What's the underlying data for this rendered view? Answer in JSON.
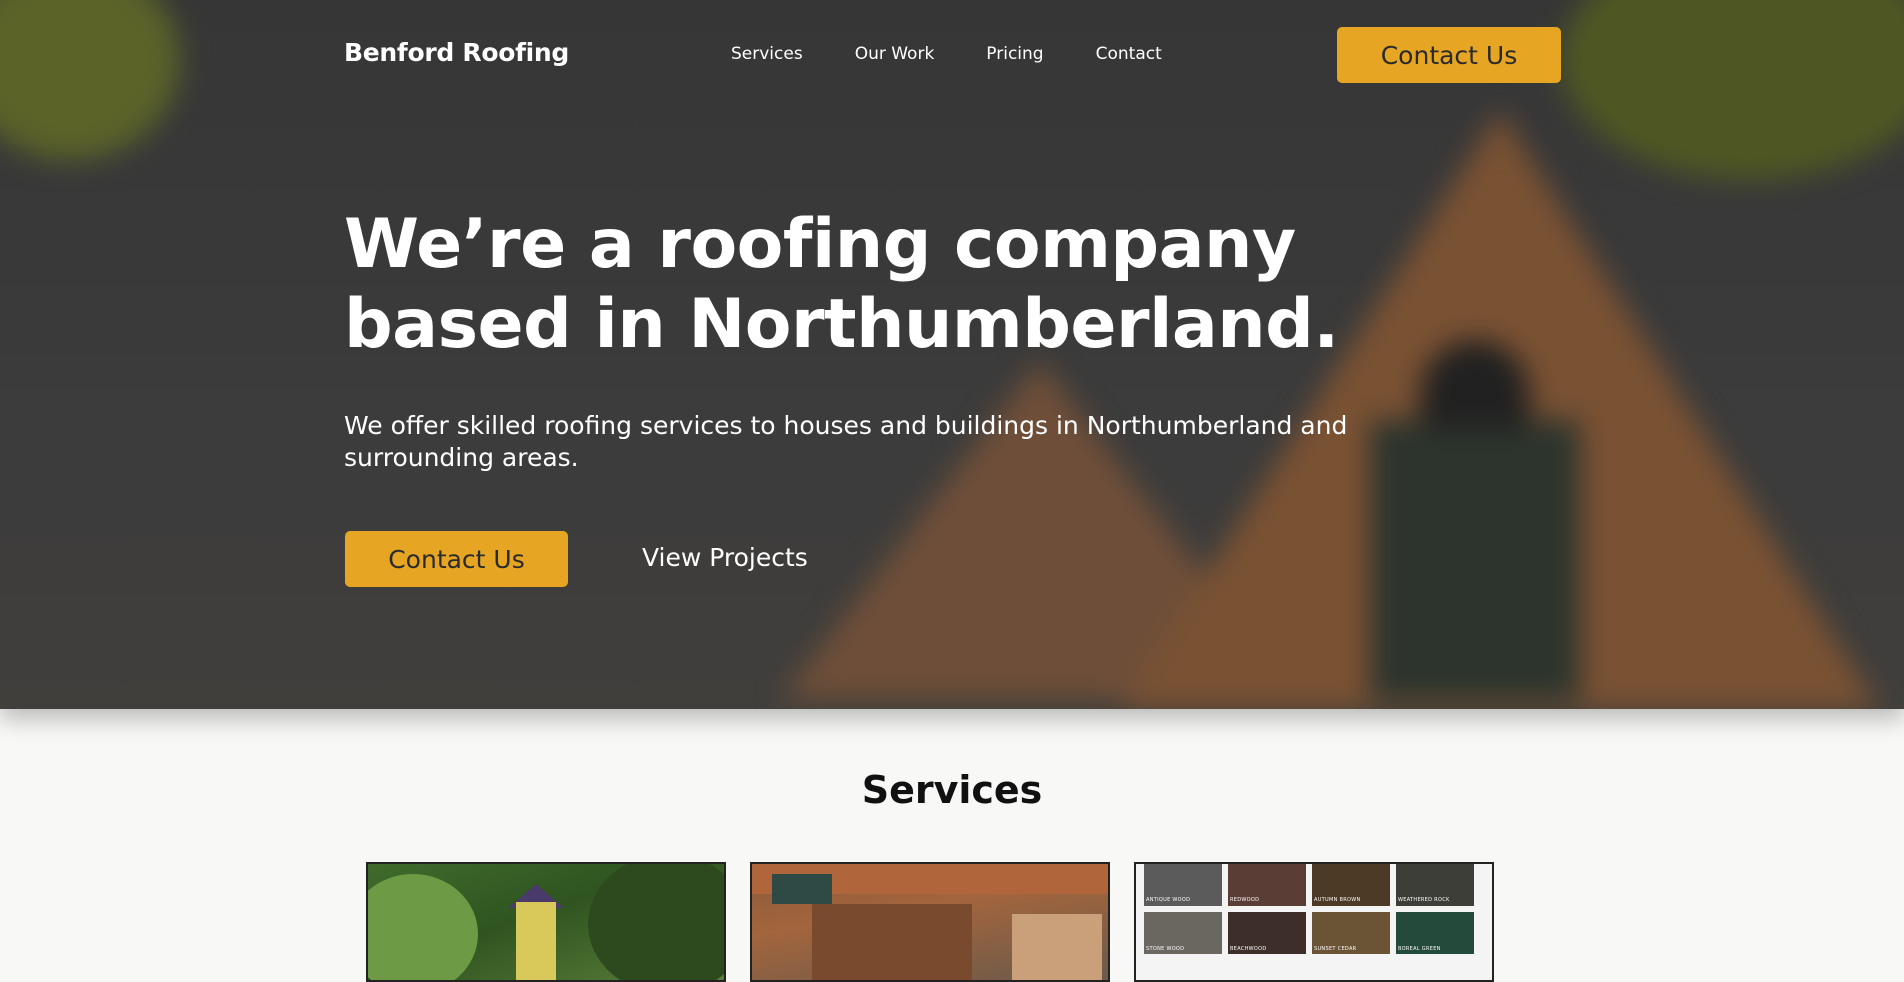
{
  "nav": {
    "brand": "Benford Roofing",
    "links": [
      "Services",
      "Our Work",
      "Pricing",
      "Contact"
    ],
    "cta": "Contact Us"
  },
  "hero": {
    "title": "We’re a roofing company based in Northumberland.",
    "subtitle": "We offer skilled roofing services to houses and buildings in Northumberland and surrounding areas.",
    "primary_cta": "Contact Us",
    "secondary_cta": "View Projects"
  },
  "services": {
    "title": "Services",
    "swatches": [
      "ANTIQUE WOOD",
      "REDWOOD",
      "AUTUMN BROWN",
      "WEATHERED ROCK",
      "STONE WOOD",
      "BEACHWOOD",
      "SUNSET CEDAR",
      "BOREAL GREEN"
    ]
  },
  "colors": {
    "accent": "#e6a623",
    "text_dark": "#111111",
    "page_bg": "#f8f8f7"
  }
}
